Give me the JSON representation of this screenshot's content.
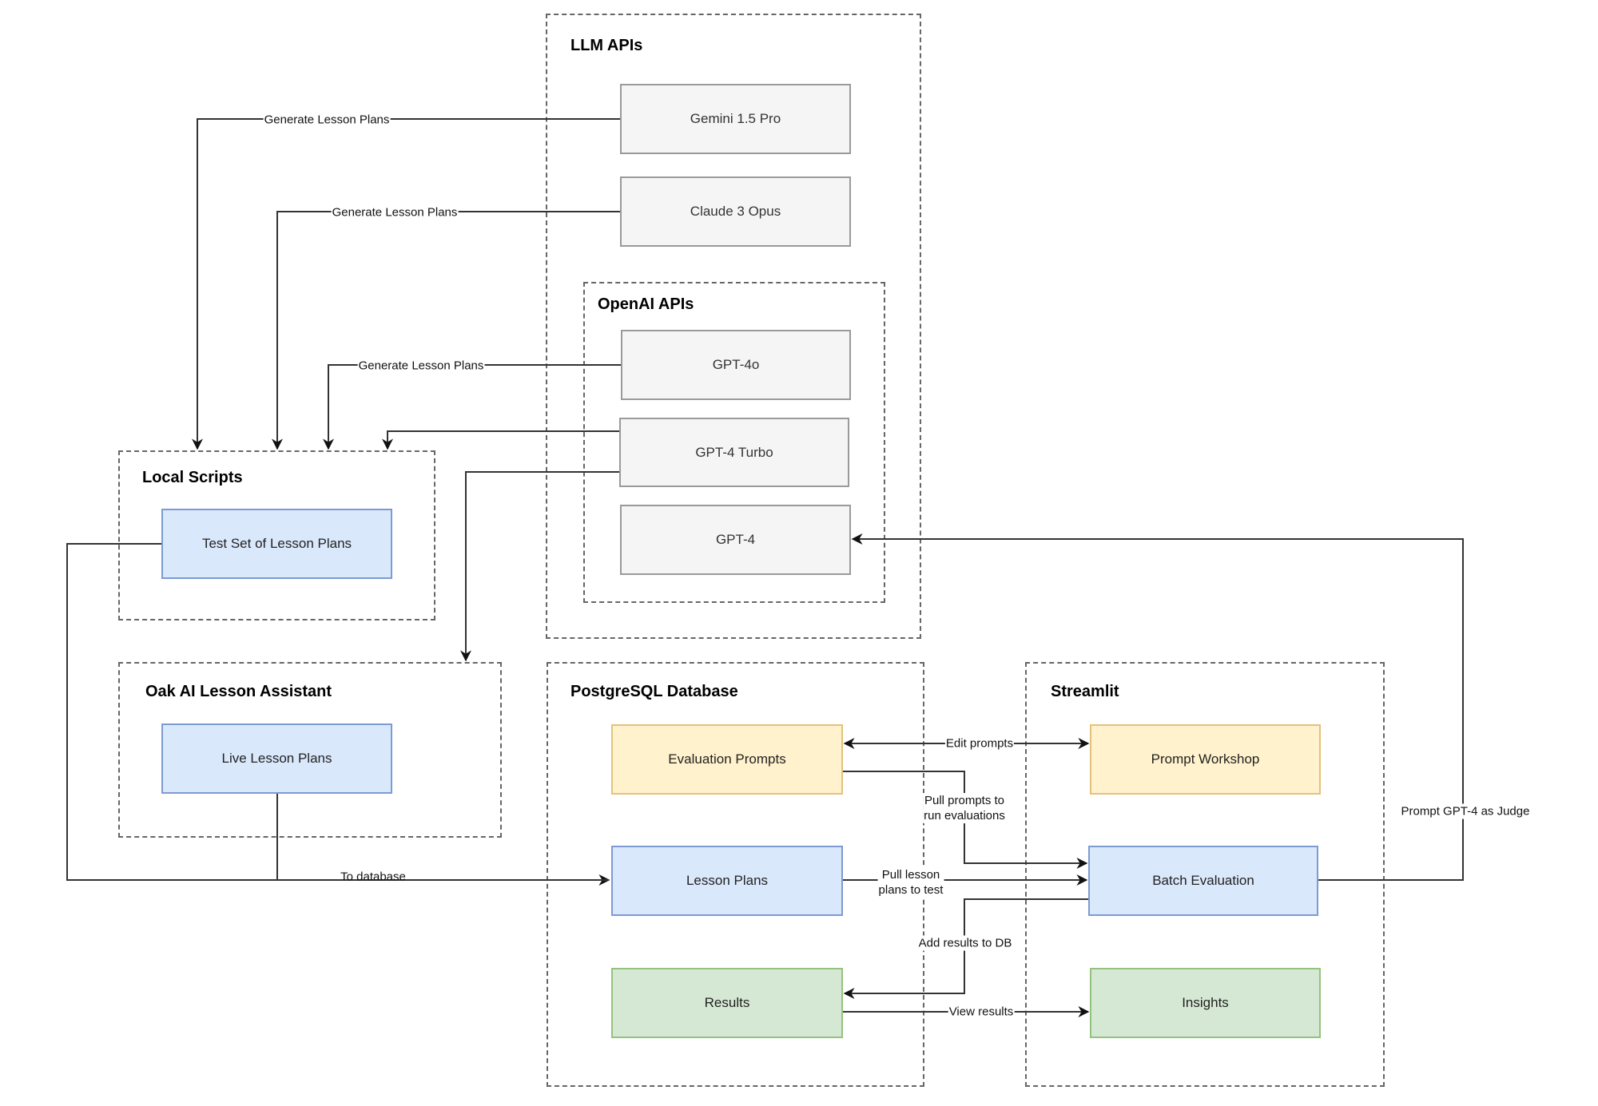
{
  "groups": {
    "llm_apis": "LLM APIs",
    "openai_apis": "OpenAI APIs",
    "local_scripts": "Local Scripts",
    "oak_ai": "Oak AI Lesson Assistant",
    "postgres": "PostgreSQL Database",
    "streamlit": "Streamlit"
  },
  "nodes": {
    "gemini": "Gemini 1.5 Pro",
    "claude": "Claude 3 Opus",
    "gpt4o": "GPT-4o",
    "gpt4turbo": "GPT-4 Turbo",
    "gpt4": "GPT-4",
    "test_set": "Test Set of Lesson Plans",
    "live_plans": "Live Lesson Plans",
    "eval_prompts": "Evaluation Prompts",
    "lesson_plans": "Lesson Plans",
    "results": "Results",
    "prompt_workshop": "Prompt Workshop",
    "batch_eval": "Batch Evaluation",
    "insights": "Insights"
  },
  "edge_labels": {
    "gen_gemini": "Generate Lesson Plans",
    "gen_claude": "Generate Lesson Plans",
    "gen_gpt4o": "Generate Lesson Plans",
    "to_database": "To database",
    "edit_prompts": "Edit prompts",
    "pull_prompts_1": "Pull prompts to",
    "pull_prompts_2": "run evaluations",
    "pull_lesson_1": "Pull lesson",
    "pull_lesson_2": "plans to test",
    "add_results": "Add results to DB",
    "view_results": "View results",
    "judge": "Prompt GPT-4 as Judge"
  },
  "colors": {
    "api_fill": "#f5f5f5",
    "data_fill": "#dae8fc",
    "prompt_fill": "#fff2cc",
    "result_fill": "#d5e8d4",
    "edge": "#333333"
  }
}
